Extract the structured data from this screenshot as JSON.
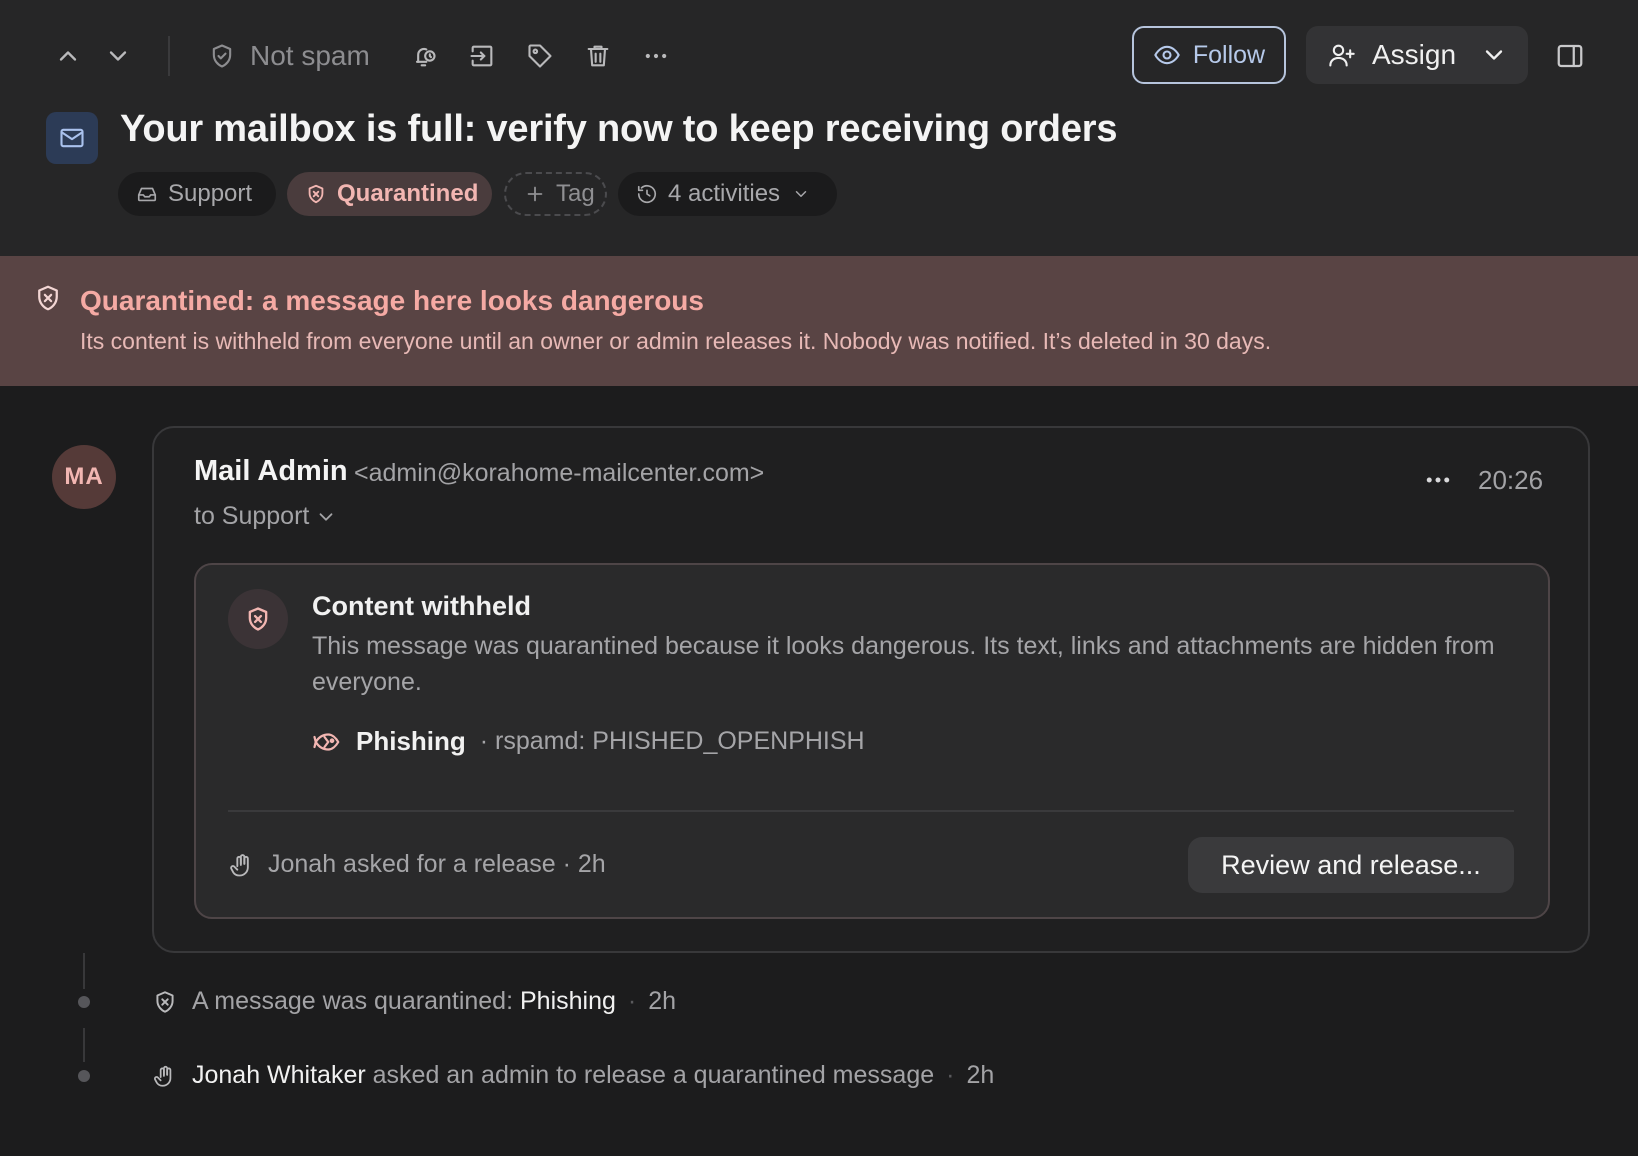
{
  "toolbar": {
    "not_spam_label": "Not spam",
    "follow_label": "Follow",
    "assign_label": "Assign"
  },
  "conversation": {
    "subject": "Your mailbox is full: verify now to keep receiving orders",
    "inbox_pill": "Support",
    "status_pill": "Quarantined",
    "tag_pill": "Tag",
    "activities_pill": "4 activities"
  },
  "banner": {
    "title": "Quarantined: a message here looks dangerous",
    "description": "Its content is withheld from everyone until an owner or admin releases it. Nobody was notified. It’s deleted in 30 days."
  },
  "message": {
    "avatar_initials": "MA",
    "sender_name": "Mail Admin",
    "sender_email": "<admin@korahome-mailcenter.com>",
    "to_label": "to Support",
    "time": "20:26",
    "withheld": {
      "title": "Content withheld",
      "description": "This message was quarantined because it looks dangerous. Its text, links and attachments are hidden from everyone.",
      "reason_name": "Phishing",
      "reason_detail": "· rspamd: PHISHED_OPENPHISH",
      "release_request": "Jonah asked for a release · 2h",
      "review_button": "Review and release..."
    }
  },
  "timeline": [
    {
      "prefix": "A message was quarantined: ",
      "strong": "Phishing",
      "suffix": "",
      "sep": "·",
      "time": "2h"
    },
    {
      "prefix": "",
      "strong": "Jonah Whitaker",
      "suffix": " asked an admin to release a quarantined message",
      "sep": "·",
      "time": "2h"
    }
  ],
  "colors": {
    "background": "#1c1c1d",
    "header_bg": "#262627",
    "banner_bg": "#594444",
    "accent_danger": "#f5aaa4",
    "follow_border": "#b6c4dc"
  },
  "icons": [
    "chevron-up-icon",
    "chevron-down-icon",
    "shield-check-icon",
    "snooze-icon",
    "move-icon",
    "tag-icon",
    "trash-icon",
    "more-icon",
    "eye-icon",
    "user-plus-icon",
    "sidebar-panel-icon",
    "mail-icon",
    "inbox-icon",
    "shield-x-icon",
    "plus-icon",
    "history-icon",
    "phishing-fish-icon",
    "hand-icon"
  ]
}
